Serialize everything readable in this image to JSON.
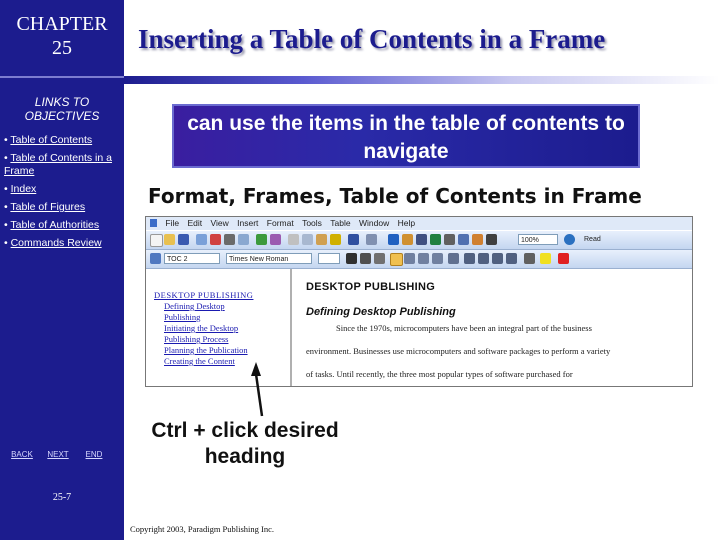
{
  "sidebar": {
    "chapter_label": "CHAPTER",
    "chapter_number": "25",
    "links_title": "LINKS TO OBJECTIVES",
    "objectives": [
      {
        "label": "Table of Contents"
      },
      {
        "label": "Table of Contents in a Frame"
      },
      {
        "label": "Index"
      },
      {
        "label": "Table of Figures"
      },
      {
        "label": "Table of Authorities"
      },
      {
        "label": "Commands Review"
      }
    ],
    "nav": {
      "back": "BACK",
      "next": "NEXT",
      "end": "END"
    },
    "page_number": "25-7"
  },
  "slide": {
    "title": "Inserting a Table of Contents in a Frame",
    "callout": "can use the items in the table of contents to navigate",
    "menu_path": "Format, Frames, Table of Contents in Frame",
    "ctrl_caption": "Ctrl + click desired heading",
    "copyright": "Copyright 2003, Paradigm Publishing Inc."
  },
  "word_screenshot": {
    "menus": [
      "File",
      "Edit",
      "View",
      "Insert",
      "Format",
      "Tools",
      "Table",
      "Window",
      "Help"
    ],
    "style_box": "TOC 2",
    "font_box": "Times New Roman",
    "zoom_box": "100%",
    "read_button": "Read",
    "toc": {
      "heading": "DESKTOP PUBLISHING",
      "items": [
        "Defining Desktop",
        "Publishing",
        "Initiating the Desktop",
        "Publishing Process",
        "Planning the Publication",
        "Creating the Content"
      ]
    },
    "document": {
      "heading1": "DESKTOP PUBLISHING",
      "heading2": "Defining Desktop Publishing",
      "lines": [
        "Since the 1970s, microcomputers have been an integral part of the business",
        "environment. Businesses use microcomputers and software packages to perform a variety",
        "of tasks. Until recently, the three most popular types of software purchased for"
      ]
    }
  },
  "colors": {
    "sidebar": "#1c1c8e",
    "title": "#1c1c8e",
    "callout": "#2a2aa8",
    "link": "#1a1ab0"
  }
}
